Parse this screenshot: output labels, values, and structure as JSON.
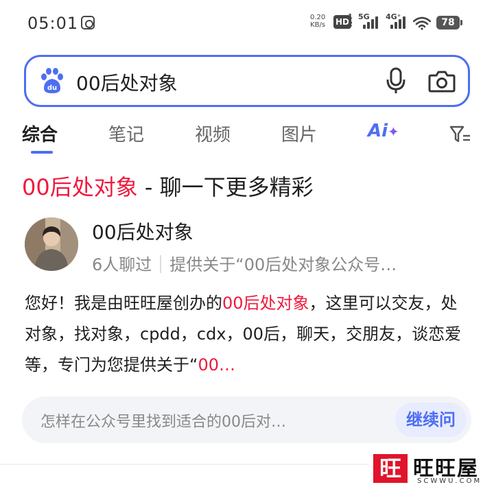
{
  "status_bar": {
    "time": "05:01",
    "speed_value": "0.20",
    "speed_unit": "KB/s",
    "hd_label": "HD",
    "hd_num_top": "1",
    "hd_num_bottom": "2",
    "net1": "5G",
    "net2": "4G⁺",
    "battery": "78"
  },
  "search": {
    "query": "00后处对象"
  },
  "tabs": [
    {
      "label": "综合",
      "active": true
    },
    {
      "label": "笔记"
    },
    {
      "label": "视频"
    },
    {
      "label": "图片"
    },
    {
      "label": "Ai"
    }
  ],
  "result": {
    "title_highlight": "00后处对象",
    "title_rest": " - 聊一下更多精彩",
    "account_name": "00后处对象",
    "chat_count": "6人聊过",
    "provides": "提供关于“00后处对象公众号…",
    "desc_part1": "您好！我是由旺旺屋创办的",
    "desc_highlight1": "00后处对象",
    "desc_part2": "，这里可以交友，处对象，找对象，cpdd，cdx，00后，聊天，交朋友，谈恋爱等，专门为您提供关于“",
    "desc_highlight2": "00…"
  },
  "followup": {
    "question": "怎样在公众号里找到适合的00后对…",
    "button": "继续问"
  },
  "watermark": {
    "seal": "旺",
    "name": "旺旺屋",
    "domain": "SCWWU.COM"
  },
  "colors": {
    "accent": "#4e6ef2",
    "highlight": "#f0193d"
  }
}
